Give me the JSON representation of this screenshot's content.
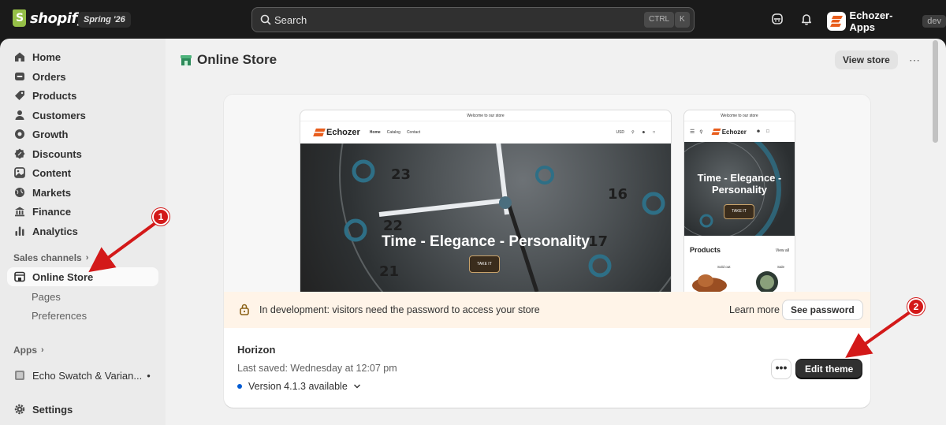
{
  "topbar": {
    "logo_text": "shopify",
    "edition": "Spring '26",
    "search_placeholder": "Search",
    "shortcut_ctrl": "CTRL",
    "shortcut_k": "K",
    "store_name": "Echozer-Apps",
    "store_badge": "dev"
  },
  "sidebar": {
    "items": [
      {
        "label": "Home",
        "icon": "home-icon"
      },
      {
        "label": "Orders",
        "icon": "orders-icon"
      },
      {
        "label": "Products",
        "icon": "tag-icon"
      },
      {
        "label": "Customers",
        "icon": "person-icon"
      },
      {
        "label": "Growth",
        "icon": "growth-icon"
      },
      {
        "label": "Discounts",
        "icon": "discount-icon"
      },
      {
        "label": "Content",
        "icon": "content-icon"
      },
      {
        "label": "Markets",
        "icon": "globe-icon"
      },
      {
        "label": "Finance",
        "icon": "bank-icon"
      },
      {
        "label": "Analytics",
        "icon": "analytics-icon"
      }
    ],
    "sales_channels_label": "Sales channels",
    "online_store_label": "Online Store",
    "sub_items": [
      "Pages",
      "Preferences"
    ],
    "apps_label": "Apps",
    "app_item_label": "Echo Swatch & Varian...",
    "settings_label": "Settings"
  },
  "page": {
    "title": "Online Store",
    "view_store_label": "View store",
    "more_label": "⋯"
  },
  "preview": {
    "announcement": "Welcome to our store",
    "brand": "Echozer",
    "nav_links": [
      "Home",
      "Catalog",
      "Contact"
    ],
    "currency": "USD",
    "hero_title": "Time - Elegance - Personality",
    "mobile_hero_title": "Time - Elegance - Personality",
    "cta": "TAKE IT",
    "products_heading": "Products",
    "view_all": "View all",
    "badge_sold_out": "Sold out",
    "badge_sale": "Sale"
  },
  "banner": {
    "text": "In development: visitors need the password to access your store",
    "learn_more": "Learn more",
    "see_password": "See password"
  },
  "theme": {
    "name": "Horizon",
    "last_saved": "Last saved: Wednesday at 12:07 pm",
    "version": "Version 4.1.3 available",
    "more_label": "•••",
    "edit_label": "Edit theme"
  },
  "annotations": {
    "marker_1": "1",
    "marker_2": "2",
    "color": "#d31919"
  },
  "colors": {
    "topbar": "#1a1a1a",
    "sidebar": "#ebebeb",
    "main": "#f1f1f1",
    "primary_button": "#303030",
    "banner": "#fff4e8",
    "version_dot": "#005bd3"
  }
}
